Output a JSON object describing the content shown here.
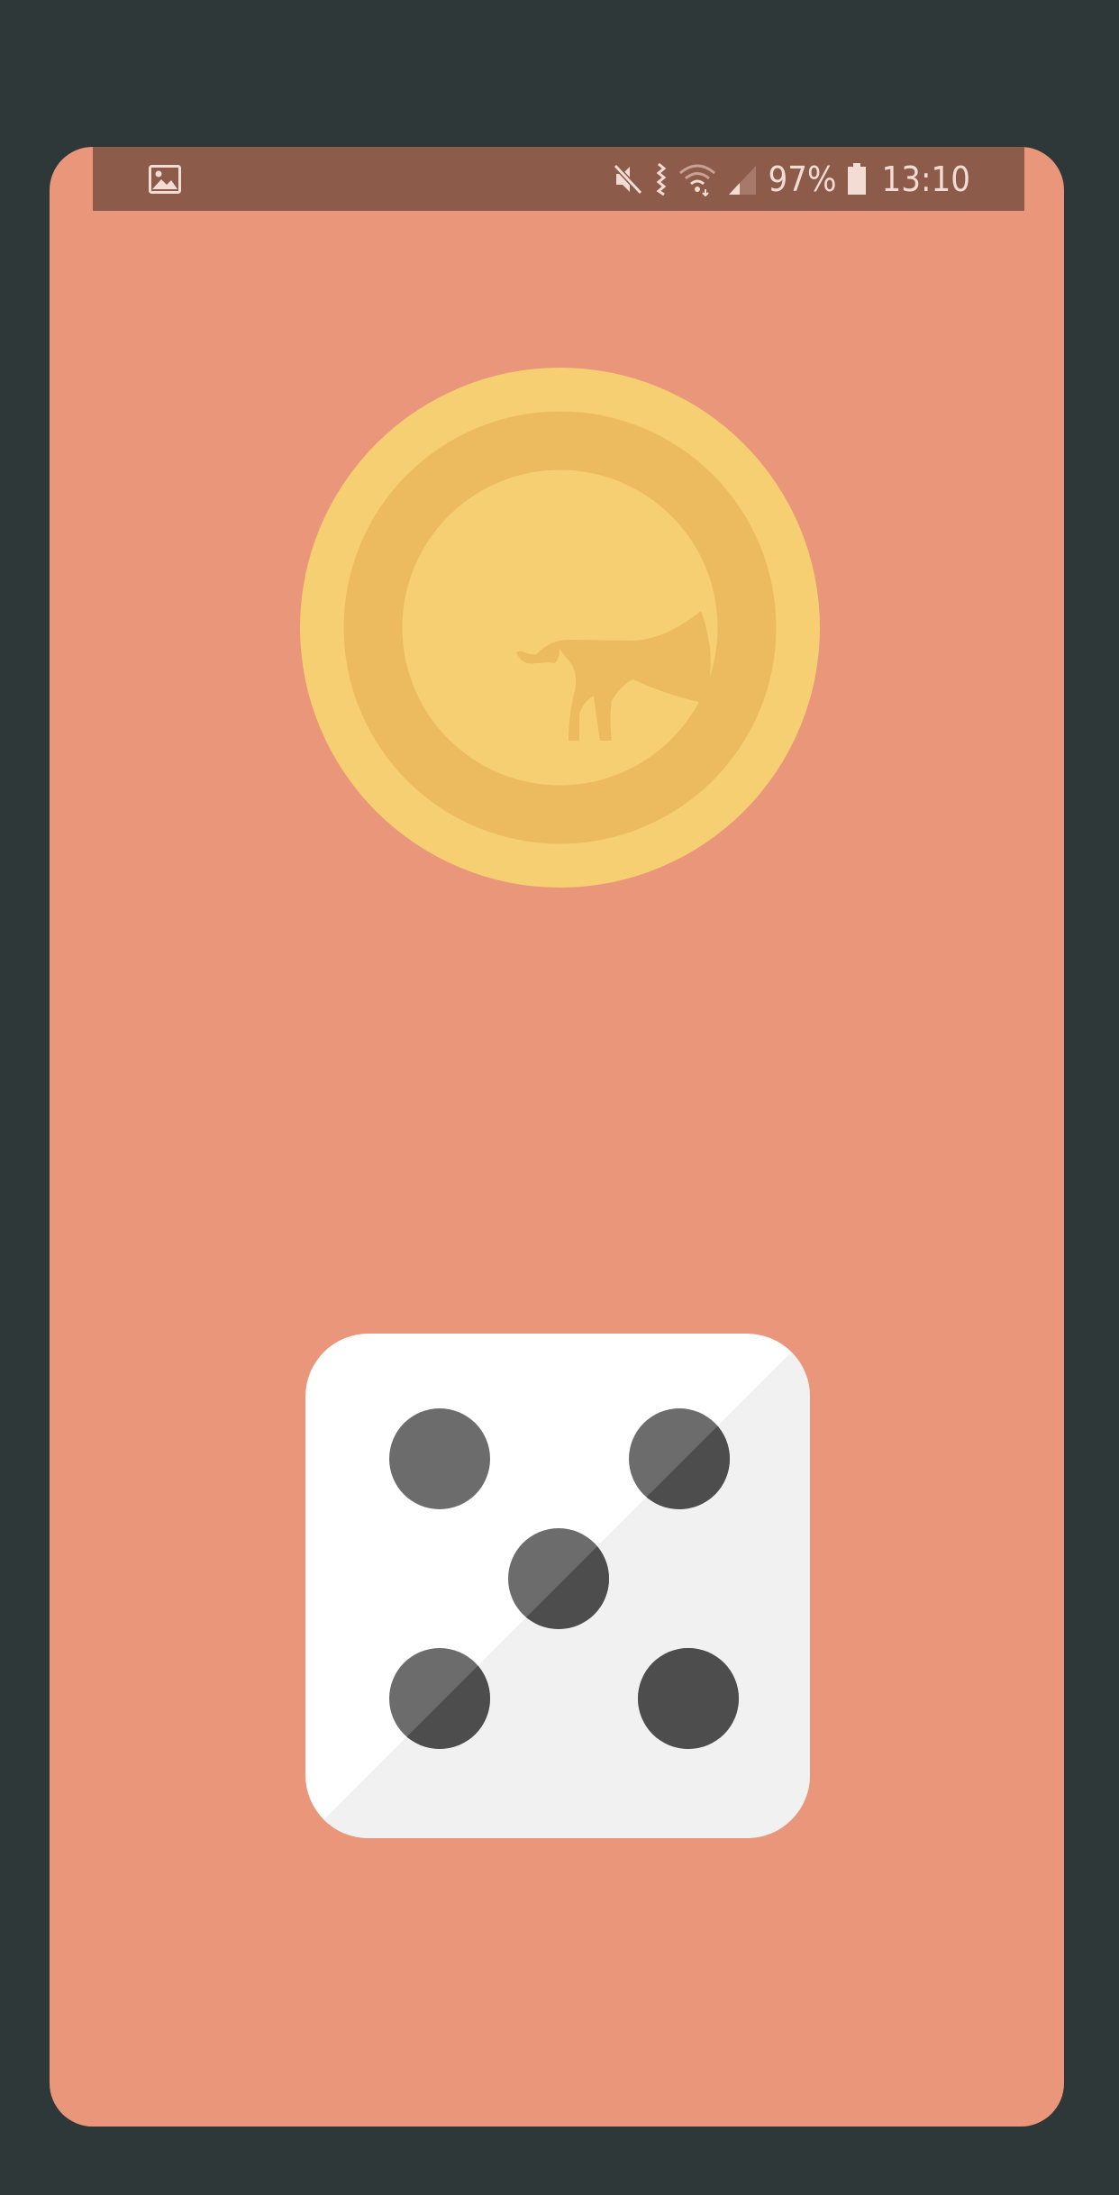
{
  "status_bar": {
    "left_icon": "gallery-notification-icon",
    "icons": [
      "mute-icon",
      "vibrate-icon",
      "wifi-icon",
      "signal-icon"
    ],
    "battery_percent": "97%",
    "time": "13:10"
  },
  "coin": {
    "icon": "coin-with-animal-icon",
    "outer_color": "#f6cf72",
    "inner_ring_color": "#ecbb5f",
    "face_color": "#f6cf72"
  },
  "dice": {
    "icon": "dice-five-icon",
    "face_value": 5,
    "pips": 5
  },
  "colors": {
    "background": "#ea967a",
    "status_bar": "#8c5b4a",
    "frame": "#2f3838"
  }
}
